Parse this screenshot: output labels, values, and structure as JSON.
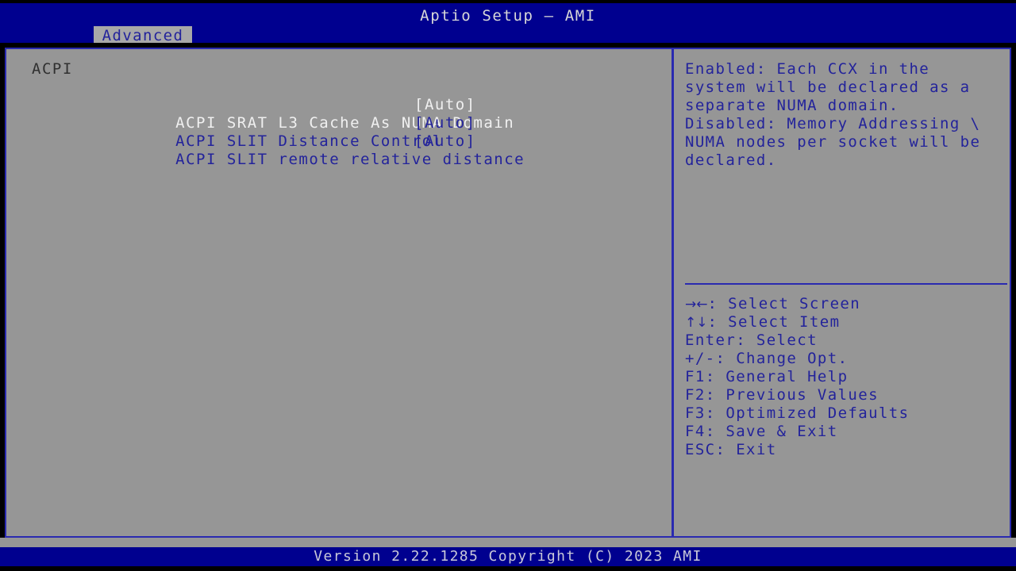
{
  "colors": {
    "header_bg": "#00008F",
    "screen_bg": "#969696",
    "border_blue": "#2A2AB0",
    "text_blue": "#23239B",
    "text_selected": "#F0F0F0",
    "tab_bg": "#A8A8A8",
    "footer_bg": "#00008F"
  },
  "header": {
    "title": "Aptio Setup – AMI",
    "tabs": [
      {
        "label": "Advanced",
        "active": true
      }
    ]
  },
  "main": {
    "group_title": "ACPI",
    "options": [
      {
        "label": "ACPI SRAT L3 Cache As NUMA Domain",
        "value": "[Auto]",
        "selected": true
      },
      {
        "label": "ACPI SLIT Distance Control",
        "value": "[Auto]",
        "selected": false
      },
      {
        "label": "ACPI SLIT remote relative distance",
        "value": "[Auto]",
        "selected": false
      }
    ]
  },
  "help": {
    "text": "Enabled: Each CCX in the\nsystem will be declared as a\nseparate NUMA domain.\nDisabled: Memory Addressing \\\nNUMA nodes per socket will be\ndeclared."
  },
  "legend": [
    {
      "glyph": "→←",
      "key": "",
      "text": ": Select Screen"
    },
    {
      "glyph": "↑↓",
      "key": "",
      "text": ": Select Item"
    },
    {
      "glyph": "",
      "key": "Enter",
      "text": ": Select"
    },
    {
      "glyph": "",
      "key": "+/-",
      "text": ": Change Opt."
    },
    {
      "glyph": "",
      "key": "F1",
      "text": ": General Help"
    },
    {
      "glyph": "",
      "key": "F2",
      "text": ": Previous Values"
    },
    {
      "glyph": "",
      "key": "F3",
      "text": ": Optimized Defaults"
    },
    {
      "glyph": "",
      "key": "F4",
      "text": ": Save & Exit"
    },
    {
      "glyph": "",
      "key": "ESC",
      "text": ": Exit"
    }
  ],
  "footer": {
    "version_text": "Version 2.22.1285 Copyright (C) 2023 AMI"
  }
}
